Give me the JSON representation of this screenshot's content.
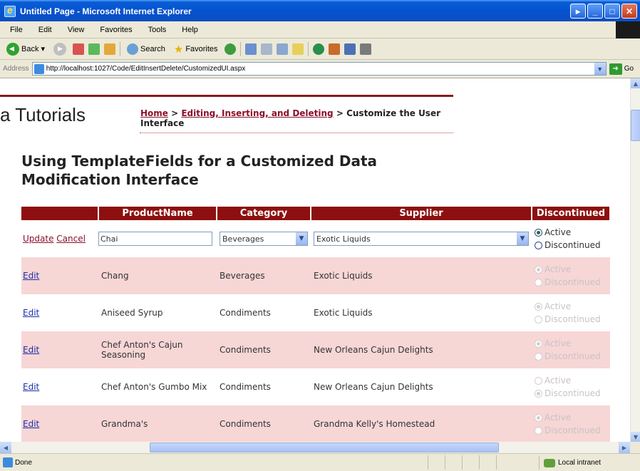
{
  "window": {
    "title": "Untitled Page - Microsoft Internet Explorer"
  },
  "menu": [
    "File",
    "Edit",
    "View",
    "Favorites",
    "Tools",
    "Help"
  ],
  "toolbar": {
    "back": "Back",
    "search": "Search",
    "favorites": "Favorites"
  },
  "address": {
    "label": "Address",
    "url": "http://localhost:1027/Code/EditInsertDelete/CustomizedUI.aspx",
    "go": "Go"
  },
  "site": {
    "title": "a Tutorials"
  },
  "breadcrumb": {
    "home": "Home",
    "sep1": " > ",
    "section": "Editing, Inserting, and Deleting",
    "sep2": " > ",
    "current": "Customize the User Interface"
  },
  "page": {
    "title": "Using TemplateFields for a Customized Data Modification Interface"
  },
  "grid": {
    "headers": {
      "product": "ProductName",
      "category": "Category",
      "supplier": "Supplier",
      "discontinued": "Discontinued"
    },
    "edit_row": {
      "update": "Update",
      "cancel": "Cancel",
      "product": "Chai",
      "category": "Beverages",
      "supplier": "Exotic Liquids",
      "active_label": "Active",
      "discontinued_label": "Discontinued",
      "status": "active"
    },
    "rows": [
      {
        "action": "Edit",
        "product": "Chang",
        "category": "Beverages",
        "supplier": "Exotic Liquids",
        "status": "active"
      },
      {
        "action": "Edit",
        "product": "Aniseed Syrup",
        "category": "Condiments",
        "supplier": "Exotic Liquids",
        "status": "active"
      },
      {
        "action": "Edit",
        "product": "Chef Anton's Cajun Seasoning",
        "category": "Condiments",
        "supplier": "New Orleans Cajun Delights",
        "status": "active"
      },
      {
        "action": "Edit",
        "product": "Chef Anton's Gumbo Mix",
        "category": "Condiments",
        "supplier": "New Orleans Cajun Delights",
        "status": "discontinued"
      },
      {
        "action": "Edit",
        "product": "Grandma's",
        "category": "Condiments",
        "supplier": "Grandma Kelly's Homestead",
        "status": "active"
      }
    ],
    "active_label": "Active",
    "discontinued_label": "Discontinued"
  },
  "status": {
    "text": "Done",
    "zone": "Local intranet"
  }
}
